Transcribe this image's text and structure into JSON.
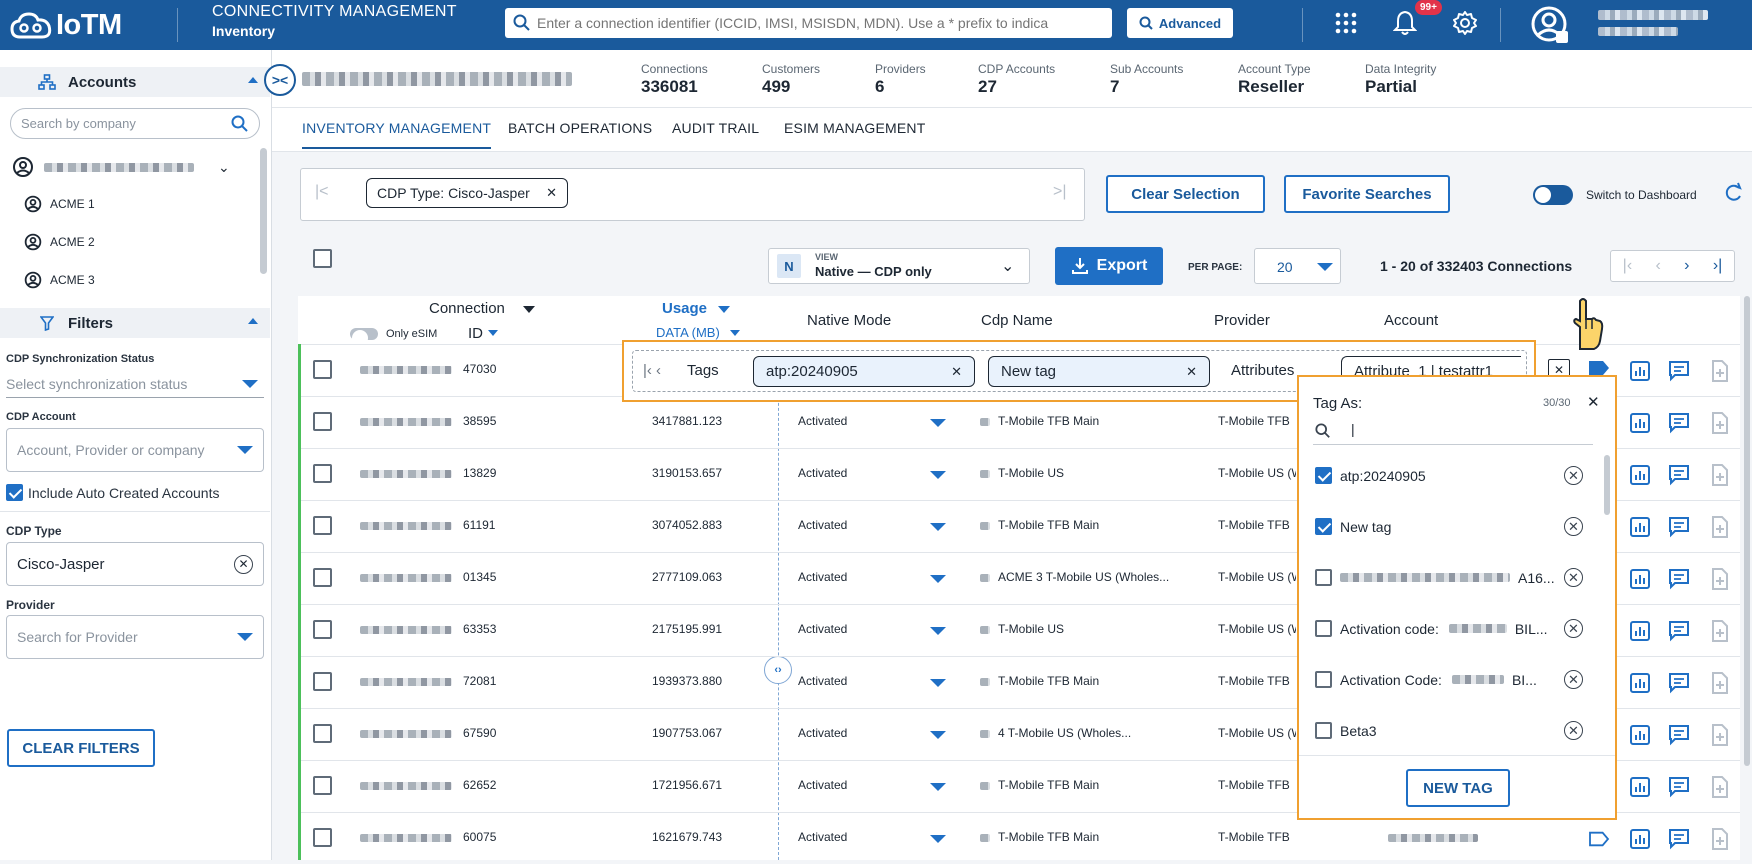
{
  "header": {
    "brand": "IoTM",
    "title": "CONNECTIVITY MANAGEMENT",
    "subtitle": "Inventory",
    "search_placeholder": "Enter a connection identifier (ICCID, IMSI, MSISDN, MDN). Use a * prefix to indica",
    "advanced_label": "Advanced",
    "notification_count": "99+",
    "icons": [
      "apps-grid-icon",
      "bell-icon",
      "gear-icon",
      "user-avatar-icon"
    ]
  },
  "sidebar": {
    "accounts_label": "Accounts",
    "search_placeholder": "Search by company",
    "accounts": [
      "ACME 1",
      "ACME 2",
      "ACME 3"
    ],
    "filters_label": "Filters",
    "sync_label": "CDP Synchronization Status",
    "sync_placeholder": "Select synchronization status",
    "cdp_account_label": "CDP Account",
    "cdp_account_placeholder": "Account, Provider or company",
    "auto_created_label": "Include Auto Created Accounts",
    "auto_created_checked": true,
    "cdp_type_label": "CDP Type",
    "cdp_type_value": "Cisco-Jasper",
    "provider_label": "Provider",
    "provider_placeholder": "Search for Provider",
    "clear_filters": "CLEAR FILTERS"
  },
  "stats": [
    {
      "key": "Connections",
      "value": "336081"
    },
    {
      "key": "Customers",
      "value": "499"
    },
    {
      "key": "Providers",
      "value": "6"
    },
    {
      "key": "CDP Accounts",
      "value": "27"
    },
    {
      "key": "Sub Accounts",
      "value": "7"
    },
    {
      "key": "Account Type",
      "value": "Reseller"
    },
    {
      "key": "Data Integrity",
      "value": "Partial"
    }
  ],
  "tabs": [
    "INVENTORY MANAGEMENT",
    "BATCH OPERATIONS",
    "AUDIT TRAIL",
    "ESIM MANAGEMENT"
  ],
  "filter_chip": "CDP Type: Cisco-Jasper",
  "clear_selection": "Clear Selection",
  "favorite_searches": "Favorite Searches",
  "switch_dashboard": "Switch to Dashboard",
  "view": {
    "badge": "N",
    "label": "VIEW",
    "value": "Native — CDP only"
  },
  "export_label": "Export",
  "per_page_label": "PER PAGE:",
  "per_page_value": "20",
  "range_text": "1 - 20 of 332403 Connections",
  "columns": {
    "connection": "Connection",
    "only_esim": "Only eSIM",
    "id": "ID",
    "usage": "Usage",
    "usage_unit": "DATA (MB)",
    "native_mode": "Native Mode",
    "cdp_name": "Cdp Name",
    "provider": "Provider",
    "account": "Account"
  },
  "rows": [
    {
      "id": "47030",
      "usage": "",
      "mode": "",
      "cdp": "",
      "provider": ""
    },
    {
      "id": "38595",
      "usage": "3417881.123",
      "mode": "Activated",
      "cdp": "T-Mobile TFB Main",
      "provider": "T-Mobile TFB"
    },
    {
      "id": "13829",
      "usage": "3190153.657",
      "mode": "Activated",
      "cdp": "T-Mobile US",
      "provider": "T-Mobile US (W"
    },
    {
      "id": "61191",
      "usage": "3074052.883",
      "mode": "Activated",
      "cdp": "T-Mobile TFB Main",
      "provider": "T-Mobile TFB"
    },
    {
      "id": "01345",
      "usage": "2777109.063",
      "mode": "Activated",
      "cdp": "ACME 3 T-Mobile US (Wholes...",
      "provider": "T-Mobile US (W"
    },
    {
      "id": "63353",
      "usage": "2175195.991",
      "mode": "Activated",
      "cdp": "T-Mobile US",
      "provider": "T-Mobile US (W"
    },
    {
      "id": "72081",
      "usage": "1939373.880",
      "mode": "Activated",
      "cdp": "T-Mobile TFB Main",
      "provider": "T-Mobile TFB"
    },
    {
      "id": "67590",
      "usage": "1907753.067",
      "mode": "Activated",
      "cdp": "4 T-Mobile US (Wholes...",
      "provider": "T-Mobile US (W"
    },
    {
      "id": "62652",
      "usage": "1721956.671",
      "mode": "Activated",
      "cdp": "T-Mobile TFB Main",
      "provider": "T-Mobile TFB"
    },
    {
      "id": "60075",
      "usage": "1621679.743",
      "mode": "Activated",
      "cdp": "T-Mobile TFB Main",
      "provider": "T-Mobile TFB"
    }
  ],
  "tag_editor": {
    "label": "Tags",
    "chips": [
      "atp:20240905",
      "New tag"
    ],
    "attributes_label": "Attributes",
    "attribute_chip": "Attribute_1 | testattr1"
  },
  "tag_dropdown": {
    "title": "Tag As:",
    "count": "30/30",
    "search_value": "|",
    "options": [
      {
        "label": "atp:20240905",
        "checked": true
      },
      {
        "label": "New tag",
        "checked": true
      },
      {
        "label": "A16...",
        "checked": false
      },
      {
        "label": "Activation code:",
        "suffix": "BIL...",
        "checked": false
      },
      {
        "label": "Activation Code:",
        "suffix": "BI...",
        "checked": false
      },
      {
        "label": "Beta3",
        "checked": false
      }
    ],
    "new_tag_label": "NEW TAG"
  },
  "colors": {
    "brand": "#1a5a9c",
    "accent": "#1f6fc5",
    "highlight": "#f0a030",
    "active_row": "#4cc05a",
    "badge": "#e2334a"
  }
}
